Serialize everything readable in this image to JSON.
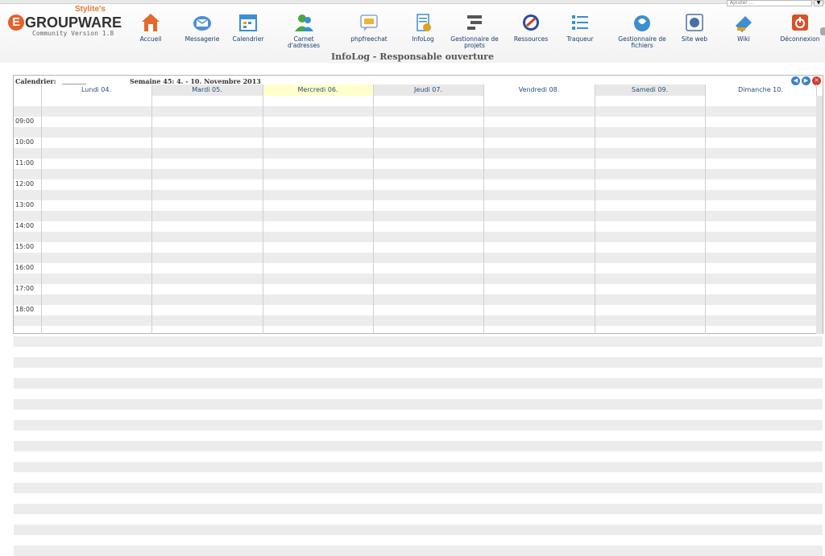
{
  "logo": {
    "tagline": "Stylite's",
    "badge": "E",
    "name": "GROUPWARE",
    "version": "Community Version 1.8"
  },
  "quick_add": {
    "value": "Ajouter ..."
  },
  "nav": [
    {
      "label": "Accueil",
      "icon": "home-icon",
      "color": "#e26a2c"
    },
    {
      "label": "Messagerie",
      "icon": "mail-icon",
      "color": "#4a8fd6"
    },
    {
      "label": "Calendrier",
      "icon": "calendar-icon",
      "color": "#3c8fd0"
    },
    {
      "label": "Carnet d'adresses",
      "icon": "addressbook-icon",
      "color": "#48a842"
    },
    {
      "label": "phpfreechat",
      "icon": "chat-icon",
      "color": "#f0b33a"
    },
    {
      "label": "InfoLog",
      "icon": "infolog-icon",
      "color": "#3c8fd0"
    },
    {
      "label": "Gestionnaire de projets",
      "icon": "projects-icon",
      "color": "#555555"
    },
    {
      "label": "Ressources",
      "icon": "resources-icon",
      "color": "#d43b2a"
    },
    {
      "label": "Traqueur",
      "icon": "tracker-icon",
      "color": "#3c8fd0"
    },
    {
      "label": "Gestionnaire de fichiers",
      "icon": "files-icon",
      "color": "#3c8fd0"
    },
    {
      "label": "Site web",
      "icon": "website-icon",
      "color": "#4a6fa5"
    },
    {
      "label": "Wiki",
      "icon": "wiki-icon",
      "color": "#3c8fd0"
    },
    {
      "label": "Déconnexion",
      "icon": "logout-icon",
      "color": "#d4542a"
    }
  ],
  "app_title": "InfoLog - Responsable ouverture",
  "calendar": {
    "label": "Calendrier:",
    "week_title": "Semaine 45: 4. - 10. Novembre 2013",
    "days": [
      "Lundi 04.",
      "Mardi 05.",
      "Mercredi 06.",
      "Jeudi 07.",
      "Vendredi 08.",
      "Samedi 09.",
      "Dimanche 10."
    ],
    "today_index": 2,
    "today_color": "#ffffcc",
    "hours": [
      "09:00",
      "10:00",
      "11:00",
      "12:00",
      "13:00",
      "14:00",
      "15:00",
      "16:00",
      "17:00",
      "18:00"
    ]
  }
}
